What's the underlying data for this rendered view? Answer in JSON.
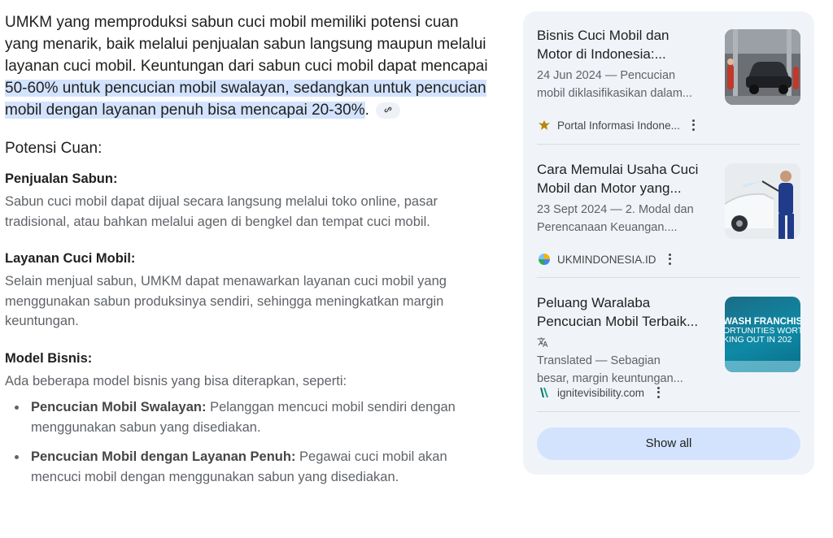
{
  "intro": {
    "text": "UMKM yang memproduksi sabun cuci mobil memiliki potensi cuan yang menarik, baik melalui penjualan sabun langsung maupun melalui layanan cuci mobil. Keuntungan dari sabun cuci mobil dapat mencapai ",
    "highlight": "50-60% untuk pencucian mobil swalayan, sedangkan untuk pencucian mobil dengan layanan penuh bisa mencapai 20-30%",
    "tail": ".",
    "link_icon": "link-icon"
  },
  "potensi_title": "Potensi Cuan:",
  "sections": [
    {
      "title": "Penjualan Sabun:",
      "text": "Sabun cuci mobil dapat dijual secara langsung melalui toko online, pasar tradisional, atau bahkan melalui agen di bengkel dan tempat cuci mobil."
    },
    {
      "title": "Layanan Cuci Mobil:",
      "text": "Selain menjual sabun, UMKM dapat menawarkan layanan cuci mobil yang menggunakan sabun produksinya sendiri, sehingga meningkatkan margin keuntungan."
    },
    {
      "title": "Model Bisnis:",
      "text": "Ada beberapa model bisnis yang bisa diterapkan, seperti:"
    }
  ],
  "bullets": [
    {
      "bold": "Pencucian Mobil Swalayan:",
      "text": " Pelanggan mencuci mobil sendiri dengan menggunakan sabun yang disediakan."
    },
    {
      "bold": "Pencucian Mobil dengan Layanan Penuh:",
      "text": " Pegawai cuci mobil akan mencuci mobil dengan menggunakan sabun yang disediakan."
    }
  ],
  "cards": [
    {
      "title_line1": "Bisnis Cuci Mobil dan",
      "title_line2": "Motor di Indonesia:...",
      "snippet_line1": "24 Jun 2024 — Pencucian",
      "snippet_line2": "mobil diklasifikasikan dalam...",
      "source": "Portal Informasi Indone...",
      "favicon": "garuda-icon"
    },
    {
      "title_line1": "Cara Memulai Usaha Cuci",
      "title_line2": "Mobil dan Motor yang...",
      "snippet_line1": "23 Sept 2024 — 2. Modal dan",
      "snippet_line2": "Perencanaan Keuangan....",
      "source": "UKMINDONESIA.ID",
      "favicon": "ukm-globe-icon"
    },
    {
      "title_line1": "Peluang Waralaba",
      "title_line2": "Pencucian Mobil Terbaik...",
      "snippet_line1": "Translated — Sebagian",
      "snippet_line2": "besar, margin keuntungan...",
      "source": "ignitevisibility.com",
      "favicon": "ignite-icon",
      "thumb_line1": "WASH FRANCHIS",
      "thumb_line2": "ORTUNITIES WORT",
      "thumb_line3": "KING OUT IN 202"
    }
  ],
  "show_all": "Show all",
  "colors": {
    "highlight": "#d3e3fd",
    "panel": "#f0f4f9",
    "button": "#d3e3fd",
    "muted_text": "#5f6368"
  }
}
